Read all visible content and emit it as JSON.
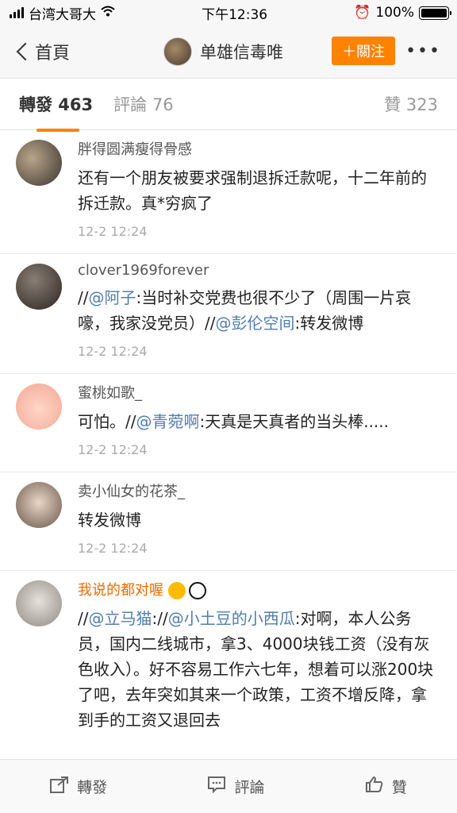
{
  "status": {
    "carrier": "台湾大哥大",
    "time": "下午12:36",
    "battery": "100%",
    "battery_level": 1.0
  },
  "nav": {
    "back_label": "首頁",
    "title": "单雄信毒唯",
    "follow_label": "＋關注",
    "more": "•••"
  },
  "tabs": {
    "forward": "轉發 463",
    "comment": "評論 76",
    "like": "贊 323"
  },
  "items": [
    {
      "name": "胖得圆满瘦得骨感",
      "text": "还有一个朋友被要求强制退拆迁款呢，十二年前的拆迁款。真*穷疯了",
      "time": "12-2 12:24"
    },
    {
      "name": "clover1969forever",
      "pre": "//",
      "at1": "@阿子",
      "mid": ":当时补交党费也很不少了（周围一片哀嚎，我家没党员）//",
      "at2": "@彭伦空间",
      "post": ":转发微博",
      "time": "12-2 12:24"
    },
    {
      "name": "蜜桃如歌_",
      "pre": "可怕。//",
      "at1": "@青菀啊",
      "post": ":天真是天真者的当头棒.....",
      "time": "12-2 12:24"
    },
    {
      "name": "卖小仙女的花茶_",
      "text": "转发微博",
      "time": "12-2 12:24"
    },
    {
      "name": "我说的都对喔",
      "pre": "//",
      "at1": "@立马猫",
      "mid": "://",
      "at2": "@小土豆的小西瓜",
      "post": ":对啊，本人公务员，国内二线城市，拿3、4000块钱工资（没有灰色收入）。好不容易工作六七年，想着可以涨200块了吧，去年突如其来一个政策，工资不增反降，拿到手的工资又退回去"
    }
  ],
  "bottom": {
    "forward": "轉發",
    "comment": "評論",
    "like": "贊"
  }
}
